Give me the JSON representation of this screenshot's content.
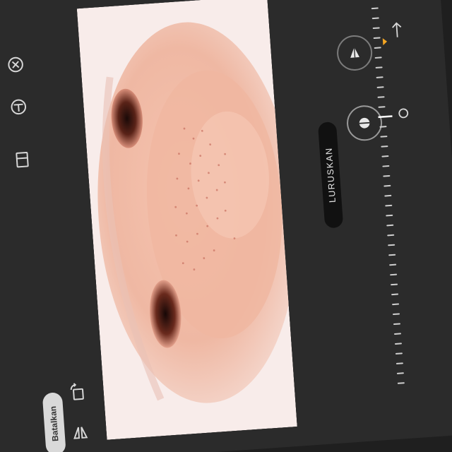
{
  "toolbar": {
    "cancel_label": "Batalkan",
    "straighten_label": "LURUSKAN"
  },
  "icons": [
    "close-circle-icon",
    "aspect-ratio-icon",
    "rotate-icon",
    "flip-icon",
    "vertical-perspective-icon",
    "straighten-icon",
    "reset-rotation-icon",
    "crop-icon"
  ],
  "colors": {
    "background": "#2b2b2b",
    "label_pill": "#111111",
    "ruler_ticks": "#cfcfcf",
    "accent_marker": "#f5a623",
    "cancel_pill": "#d9d9d9"
  },
  "photo": {
    "subject": "close-up of a nose"
  }
}
